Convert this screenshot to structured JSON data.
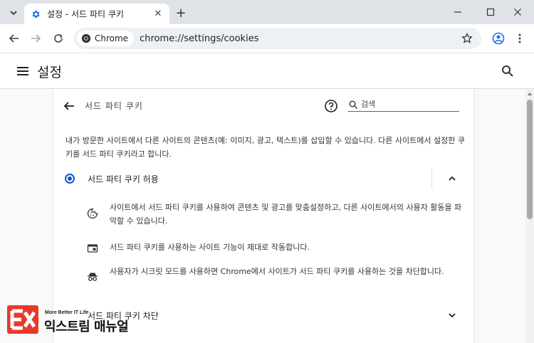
{
  "browser": {
    "tab": {
      "title": "설정 - 서드 파티 쿠키",
      "close_glyph": "✕"
    },
    "newtab_glyph": "+",
    "omnibox": {
      "chip_label": "Chrome",
      "url": "chrome://settings/cookies"
    }
  },
  "settings": {
    "header_title": "설정"
  },
  "page": {
    "heading": "서드 파티 쿠키",
    "search_placeholder": "검색",
    "description": "내가 방문한 사이트에서 다른 사이트의 콘텐츠(예: 이미지, 광고, 텍스트)를 삽입할 수 있습니다. 다른 사이트에서 설정한 쿠키를 서드 파티 쿠키라고 합니다.",
    "options": [
      {
        "label": "서드 파티 쿠키 허용",
        "selected": true,
        "expanded": true,
        "details": [
          {
            "icon": "cookie-icon",
            "text": "사이트에서 서드 파티 쿠키를 사용하여 콘텐츠 및 광고를 맞춤설정하고, 다른 사이트에서의 사용자 활동을 파악할 수 있습니다."
          },
          {
            "icon": "web-page-icon",
            "text": "서드 파티 쿠키를 사용하는 사이트 기능이 제대로 작동합니다."
          },
          {
            "icon": "incognito-icon",
            "text": "사용자가 시크릿 모드를 사용하면 Chrome에서 사이트가 서드 파티 쿠키를 사용하는 것을 차단합니다."
          }
        ]
      },
      {
        "label": "서드 파티 쿠키 차단",
        "selected": false,
        "expanded": false
      }
    ]
  },
  "watermark": {
    "tagline": "More Better IT Life",
    "brand": "익스트림 매뉴얼"
  },
  "colors": {
    "accent": "#0b57d0",
    "tabstrip": "#dfe3e7",
    "logo_red": "#e8392b"
  }
}
